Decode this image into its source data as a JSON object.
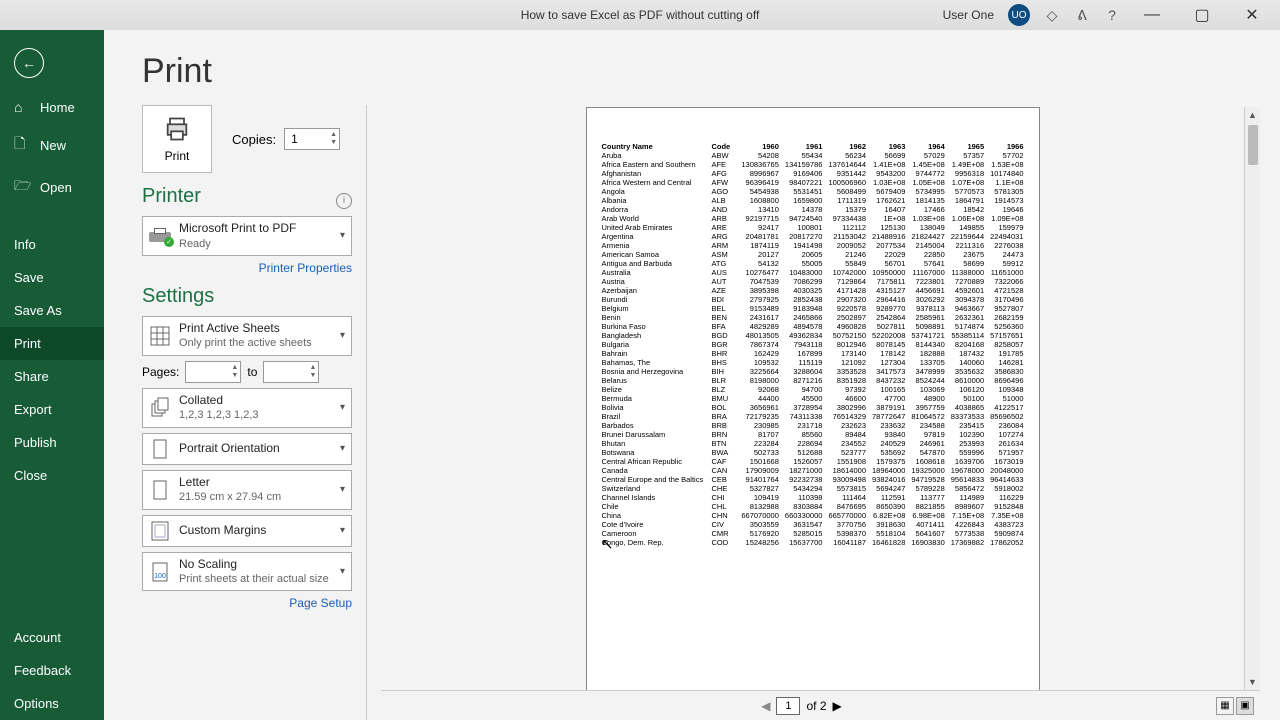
{
  "titlebar": {
    "title": "How to save Excel as PDF without cutting off",
    "user": "User One",
    "initials": "UO"
  },
  "sidebar": {
    "top": [
      {
        "icon": "⌂",
        "label": "Home"
      },
      {
        "icon": "🗋",
        "label": "New"
      },
      {
        "icon": "🗁",
        "label": "Open"
      }
    ],
    "middle": [
      {
        "label": "Info"
      },
      {
        "label": "Save"
      },
      {
        "label": "Save As"
      },
      {
        "label": "Print"
      },
      {
        "label": "Share"
      },
      {
        "label": "Export"
      },
      {
        "label": "Publish"
      },
      {
        "label": "Close"
      }
    ],
    "bottom": [
      {
        "label": "Account"
      },
      {
        "label": "Feedback"
      },
      {
        "label": "Options"
      }
    ],
    "active": "Print"
  },
  "page": {
    "title": "Print",
    "print_button": "Print",
    "copies_label": "Copies:",
    "copies_value": "1"
  },
  "printer": {
    "heading": "Printer",
    "name": "Microsoft Print to PDF",
    "status": "Ready",
    "properties_link": "Printer Properties"
  },
  "settings": {
    "heading": "Settings",
    "print_what": {
      "line1": "Print Active Sheets",
      "line2": "Only print the active sheets"
    },
    "pages_label": "Pages:",
    "to_label": "to",
    "collated": {
      "line1": "Collated",
      "line2": "1,2,3    1,2,3    1,2,3"
    },
    "orientation": {
      "line1": "Portrait Orientation"
    },
    "paper": {
      "line1": "Letter",
      "line2": "21.59 cm x 27.94 cm"
    },
    "margins": {
      "line1": "Custom Margins"
    },
    "scaling": {
      "line1": "No Scaling",
      "line2": "Print sheets at their actual size"
    },
    "page_setup_link": "Page Setup"
  },
  "preview": {
    "headers": [
      "Country Name",
      "Code",
      "1960",
      "1961",
      "1962",
      "1963",
      "1964",
      "1965",
      "1966"
    ],
    "rows": [
      [
        "Aruba",
        "ABW",
        "54208",
        "55434",
        "56234",
        "56699",
        "57029",
        "57357",
        "57702"
      ],
      [
        "Africa Eastern and Southern",
        "AFE",
        "130836765",
        "134159786",
        "137614644",
        "1.41E+08",
        "1.45E+08",
        "1.49E+08",
        "1.53E+08"
      ],
      [
        "Afghanistan",
        "AFG",
        "8996967",
        "9169406",
        "9351442",
        "9543200",
        "9744772",
        "9956318",
        "10174840"
      ],
      [
        "Africa Western and Central",
        "AFW",
        "96396419",
        "98407221",
        "100506960",
        "1.03E+08",
        "1.05E+08",
        "1.07E+08",
        "1.1E+08"
      ],
      [
        "Angola",
        "AGO",
        "5454938",
        "5531451",
        "5608499",
        "5679409",
        "5734995",
        "5770573",
        "5781305"
      ],
      [
        "Albania",
        "ALB",
        "1608800",
        "1659800",
        "1711319",
        "1762621",
        "1814135",
        "1864791",
        "1914573"
      ],
      [
        "Andorra",
        "AND",
        "13410",
        "14378",
        "15379",
        "16407",
        "17466",
        "18542",
        "19646"
      ],
      [
        "Arab World",
        "ARB",
        "92197715",
        "94724540",
        "97334438",
        "1E+08",
        "1.03E+08",
        "1.06E+08",
        "1.09E+08"
      ],
      [
        "United Arab Emirates",
        "ARE",
        "92417",
        "100801",
        "112112",
        "125130",
        "138049",
        "149855",
        "159979"
      ],
      [
        "Argentina",
        "ARG",
        "20481781",
        "20817270",
        "21153042",
        "21488916",
        "21824427",
        "22159644",
        "22494031"
      ],
      [
        "Armenia",
        "ARM",
        "1874119",
        "1941498",
        "2009052",
        "2077534",
        "2145004",
        "2211316",
        "2276038"
      ],
      [
        "American Samoa",
        "ASM",
        "20127",
        "20605",
        "21246",
        "22029",
        "22850",
        "23675",
        "24473"
      ],
      [
        "Antigua and Barbuda",
        "ATG",
        "54132",
        "55005",
        "55849",
        "56701",
        "57641",
        "58699",
        "59912"
      ],
      [
        "Australia",
        "AUS",
        "10276477",
        "10483000",
        "10742000",
        "10950000",
        "11167000",
        "11388000",
        "11651000"
      ],
      [
        "Austria",
        "AUT",
        "7047539",
        "7086299",
        "7129864",
        "7175811",
        "7223801",
        "7270889",
        "7322066"
      ],
      [
        "Azerbaijan",
        "AZE",
        "3895398",
        "4030325",
        "4171428",
        "4315127",
        "4456691",
        "4592601",
        "4721528"
      ],
      [
        "Burundi",
        "BDI",
        "2797925",
        "2852438",
        "2907320",
        "2964416",
        "3026292",
        "3094378",
        "3170496"
      ],
      [
        "Belgium",
        "BEL",
        "9153489",
        "9183948",
        "9220578",
        "9289770",
        "9378113",
        "9463667",
        "9527807"
      ],
      [
        "Benin",
        "BEN",
        "2431617",
        "2465866",
        "2502897",
        "2542864",
        "2585961",
        "2632361",
        "2682159"
      ],
      [
        "Burkina Faso",
        "BFA",
        "4829289",
        "4894578",
        "4960828",
        "5027811",
        "5098891",
        "5174874",
        "5256360"
      ],
      [
        "Bangladesh",
        "BGD",
        "48013505",
        "49362834",
        "50752150",
        "52202008",
        "53741721",
        "55385114",
        "57157651"
      ],
      [
        "Bulgaria",
        "BGR",
        "7867374",
        "7943118",
        "8012946",
        "8078145",
        "8144340",
        "8204168",
        "8258057"
      ],
      [
        "Bahrain",
        "BHR",
        "162429",
        "167899",
        "173140",
        "178142",
        "182888",
        "187432",
        "191785"
      ],
      [
        "Bahamas, The",
        "BHS",
        "109532",
        "115119",
        "121092",
        "127304",
        "133705",
        "140060",
        "146281"
      ],
      [
        "Bosnia and Herzegovina",
        "BIH",
        "3225664",
        "3288604",
        "3353528",
        "3417573",
        "3478999",
        "3535632",
        "3586830"
      ],
      [
        "Belarus",
        "BLR",
        "8198000",
        "8271216",
        "8351928",
        "8437232",
        "8524244",
        "8610000",
        "8696496"
      ],
      [
        "Belize",
        "BLZ",
        "92068",
        "94700",
        "97392",
        "100165",
        "103069",
        "106120",
        "109348"
      ],
      [
        "Bermuda",
        "BMU",
        "44400",
        "45500",
        "46600",
        "47700",
        "48900",
        "50100",
        "51000"
      ],
      [
        "Bolivia",
        "BOL",
        "3656961",
        "3728954",
        "3802996",
        "3879191",
        "3957759",
        "4038865",
        "4122517"
      ],
      [
        "Brazil",
        "BRA",
        "72179235",
        "74311338",
        "76514329",
        "78772647",
        "81064572",
        "83373533",
        "85696502"
      ],
      [
        "Barbados",
        "BRB",
        "230985",
        "231718",
        "232623",
        "233632",
        "234588",
        "235415",
        "236084"
      ],
      [
        "Brunei Darussalam",
        "BRN",
        "81707",
        "85560",
        "89484",
        "93840",
        "97819",
        "102390",
        "107274"
      ],
      [
        "Bhutan",
        "BTN",
        "223284",
        "228694",
        "234552",
        "240529",
        "246961",
        "253993",
        "261634"
      ],
      [
        "Botswana",
        "BWA",
        "502733",
        "512688",
        "523777",
        "535692",
        "547870",
        "559996",
        "571957"
      ],
      [
        "Central African Republic",
        "CAF",
        "1501668",
        "1526057",
        "1551908",
        "1579375",
        "1608618",
        "1639706",
        "1673019"
      ],
      [
        "Canada",
        "CAN",
        "17909009",
        "18271000",
        "18614000",
        "18964000",
        "19325000",
        "19678000",
        "20048000"
      ],
      [
        "Central Europe and the Baltics",
        "CEB",
        "91401764",
        "92232738",
        "93009498",
        "93824016",
        "94719528",
        "95614833",
        "96414633"
      ],
      [
        "Switzerland",
        "CHE",
        "5327827",
        "5434294",
        "5573815",
        "5694247",
        "5789228",
        "5856472",
        "5918002"
      ],
      [
        "Channel Islands",
        "CHI",
        "109419",
        "110398",
        "111464",
        "112591",
        "113777",
        "114989",
        "116229"
      ],
      [
        "Chile",
        "CHL",
        "8132988",
        "8303884",
        "8476695",
        "8650390",
        "8821855",
        "8989607",
        "9152848"
      ],
      [
        "China",
        "CHN",
        "667070000",
        "660330000",
        "665770000",
        "6.82E+08",
        "6.98E+08",
        "7.15E+08",
        "7.35E+08"
      ],
      [
        "Cote d'Ivoire",
        "CIV",
        "3503559",
        "3631547",
        "3770756",
        "3918630",
        "4071411",
        "4226843",
        "4383723"
      ],
      [
        "Cameroon",
        "CMR",
        "5176920",
        "5285015",
        "5398370",
        "5518104",
        "5641607",
        "5773538",
        "5909874"
      ],
      [
        "Congo, Dem. Rep.",
        "COD",
        "15248256",
        "15637700",
        "16041187",
        "16461828",
        "16903830",
        "17369882",
        "17862052"
      ]
    ],
    "page_input": "1",
    "page_total": "of 2"
  }
}
